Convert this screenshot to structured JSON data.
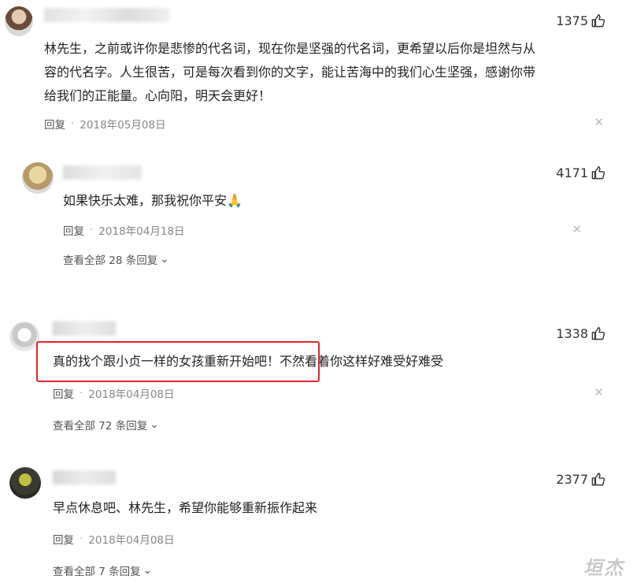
{
  "comments": [
    {
      "likes": "1375",
      "text_lines": [
        "林先生，之前或许你是悲惨的代名词，现在你是坚强的代名词，更希望以后你是坦然与从",
        "容的代名字。人生很苦，可是每次看到你的文字，能让苦海中的我们心生坚强，感谢你带",
        "给我们的正能量。心向阳，明天会更好！"
      ],
      "reply_label": "回复",
      "date": "2018年05月08日"
    },
    {
      "likes": "4171",
      "text_lines": [
        "如果快乐太难，那我祝你平安🙏"
      ],
      "reply_label": "回复",
      "date": "2018年04月18日",
      "view_all": "查看全部 28 条回复"
    },
    {
      "likes": "1338",
      "text_lines": [
        "真的找个跟小贞一样的女孩重新开始吧！不然看着你这样好难受好难受"
      ],
      "reply_label": "回复",
      "date": "2018年04月08日",
      "view_all": "查看全部 72 条回复"
    },
    {
      "likes": "2377",
      "text_lines": [
        "早点休息吧、林先生，希望你能够重新振作起来"
      ],
      "reply_label": "回复",
      "date": "2018年04月08日",
      "view_all": "查看全部 7 条回复"
    }
  ],
  "icons": {
    "like": "thumbs-up-icon",
    "close": "close-icon",
    "expand": "chevron-down-icon"
  },
  "watermark": "垣杰",
  "colors": {
    "highlight_border": "#e0252b",
    "meta_text": "#888888",
    "watermark": "#c9c9cc"
  }
}
